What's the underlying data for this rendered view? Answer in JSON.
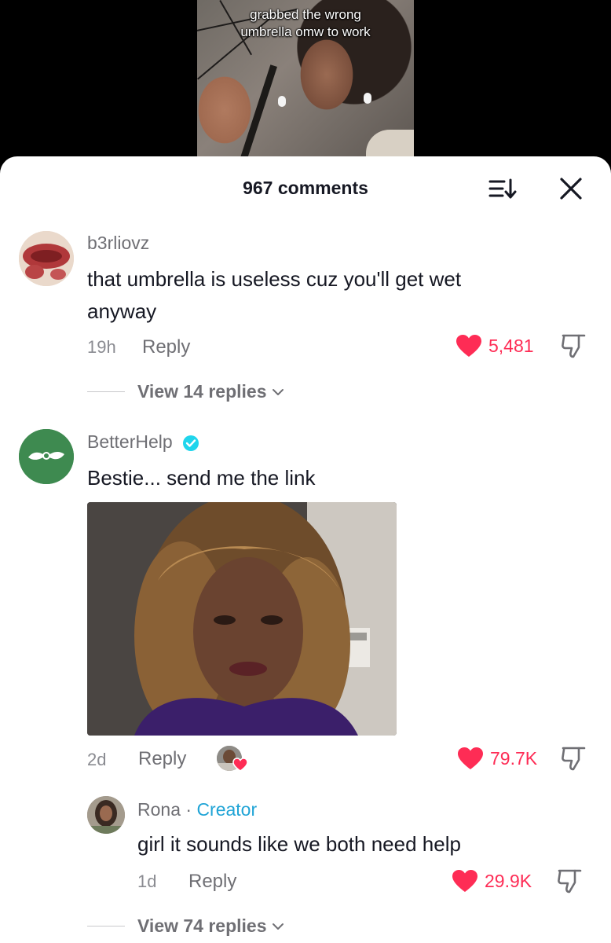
{
  "video": {
    "caption_line1": "grabbed the wrong",
    "caption_line2": "umbrella omw to work"
  },
  "header": {
    "title": "967 comments",
    "sort_icon": "sort-icon",
    "close_icon": "close-icon"
  },
  "comments": [
    {
      "username": "b3rliovz",
      "text_line1": "that umbrella is useless cuz you'll get wet",
      "text_line2": "anyway",
      "time": "19h",
      "reply_label": "Reply",
      "likes": "5,481",
      "view_replies": "View 14 replies"
    },
    {
      "username": "BetterHelp",
      "verified": true,
      "text": "Bestie... send me the link",
      "time": "2d",
      "reply_label": "Reply",
      "likes": "79.7K"
    },
    {
      "username": "Rona",
      "separator": " · ",
      "tag": "Creator",
      "text": "girl it sounds like we both need help",
      "time": "1d",
      "reply_label": "Reply",
      "likes": "29.9K",
      "view_replies": "View 74 replies"
    }
  ],
  "colors": {
    "like_red": "#fe2c55",
    "creator_blue": "#20a4d6",
    "betterhelp_green": "#3e8a50",
    "verified_blue": "#20d5ec"
  }
}
